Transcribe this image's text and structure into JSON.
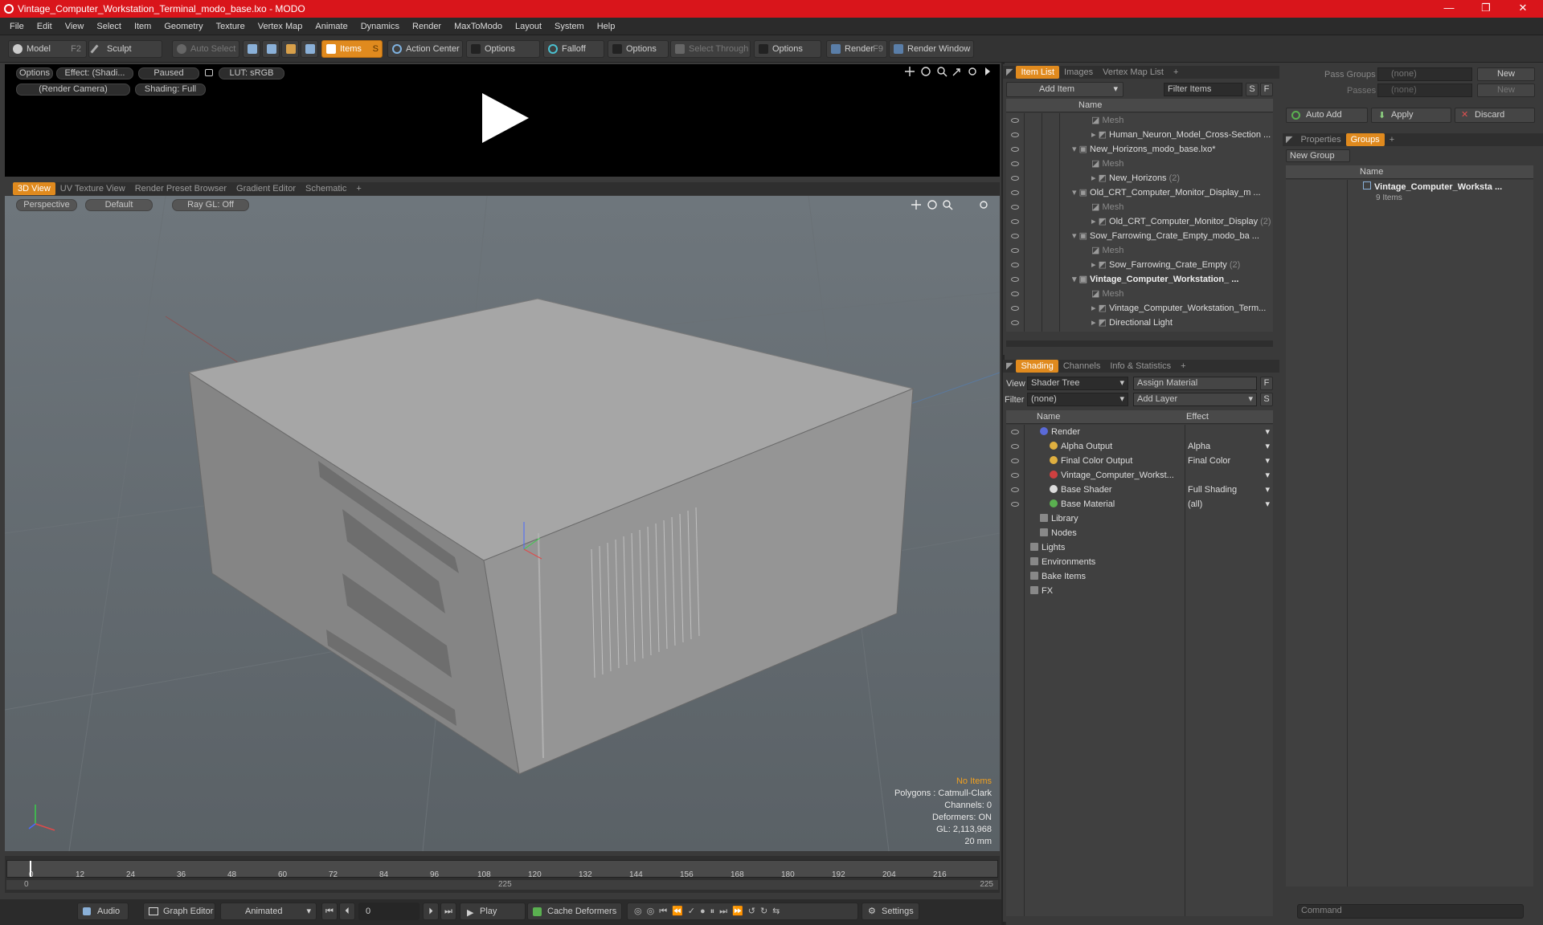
{
  "window": {
    "title": "Vintage_Computer_Workstation_Terminal_modo_base.lxo - MODO",
    "min": "—",
    "max": "❐",
    "close": "✕"
  },
  "menu": [
    "File",
    "Edit",
    "View",
    "Select",
    "Item",
    "Geometry",
    "Texture",
    "Vertex Map",
    "Animate",
    "Dynamics",
    "Render",
    "MaxToModo",
    "Layout",
    "System",
    "Help"
  ],
  "toolbar": {
    "model": "Model",
    "model_key": "F2",
    "sculpt": "Sculpt",
    "auto_select": "Auto Select",
    "items": "Items",
    "items_key": "S",
    "action_center": "Action Center",
    "options1": "Options",
    "falloff": "Falloff",
    "options2": "Options",
    "select_through": "Select Through",
    "options3": "Options",
    "render": "Render",
    "render_key": "F9",
    "render_window": "Render Window"
  },
  "preview": {
    "options": "Options",
    "effect": "Effect: (Shadi...",
    "paused": "Paused",
    "lut": "LUT: sRGB",
    "camera": "(Render Camera)",
    "shading": "Shading: Full"
  },
  "view_tabs": [
    "3D View",
    "UV Texture View",
    "Render Preset Browser",
    "Gradient Editor",
    "Schematic",
    "+"
  ],
  "viewport": {
    "perspective": "Perspective",
    "default": "Default",
    "raygl": "Ray GL: Off",
    "hud": {
      "no_items": "No Items",
      "polygons": "Polygons : Catmull-Clark",
      "channels": "Channels: 0",
      "deformers": "Deformers: ON",
      "gl": "GL: 2,113,968",
      "scale": "20 mm"
    }
  },
  "timeline": {
    "ticks": [
      "0",
      "12",
      "24",
      "36",
      "48",
      "60",
      "72",
      "84",
      "96",
      "108",
      "120",
      "132",
      "144",
      "156",
      "168",
      "180",
      "192",
      "204",
      "216"
    ],
    "start": "0",
    "mid": "225",
    "end": "225"
  },
  "bottombar": {
    "audio": "Audio",
    "graph_editor": "Graph Editor",
    "animated": "Animated",
    "frame": "0",
    "play": "Play",
    "cache": "Cache Deformers",
    "settings": "Settings"
  },
  "itemlist": {
    "tabs": [
      "Item List",
      "Images",
      "Vertex Map List",
      "+"
    ],
    "add_item": "Add Item",
    "filter": "Filter Items",
    "s": "S",
    "f": "F",
    "col_name": "Name",
    "rows": [
      {
        "label": "Mesh",
        "kind": "dim",
        "indent": 3
      },
      {
        "label": "Human_Neuron_Model_Cross-Section ...",
        "kind": "norm",
        "indent": 3
      },
      {
        "label": "New_Horizons_modo_base.lxo*",
        "kind": "norm",
        "indent": 1
      },
      {
        "label": "Mesh",
        "kind": "dim",
        "indent": 3
      },
      {
        "label": "New_Horizons",
        "count": "(2)",
        "kind": "norm",
        "indent": 3
      },
      {
        "label": "Old_CRT_Computer_Monitor_Display_m ...",
        "kind": "norm",
        "indent": 1
      },
      {
        "label": "Mesh",
        "kind": "dim",
        "indent": 3
      },
      {
        "label": "Old_CRT_Computer_Monitor_Display",
        "count": "(2)",
        "kind": "norm",
        "indent": 3
      },
      {
        "label": "Sow_Farrowing_Crate_Empty_modo_ba ...",
        "kind": "norm",
        "indent": 1
      },
      {
        "label": "Mesh",
        "kind": "dim",
        "indent": 3
      },
      {
        "label": "Sow_Farrowing_Crate_Empty",
        "count": "(2)",
        "kind": "norm",
        "indent": 3
      },
      {
        "label": "Vintage_Computer_Workstation_ ...",
        "kind": "bold",
        "indent": 1
      },
      {
        "label": "Mesh",
        "kind": "dim",
        "indent": 3
      },
      {
        "label": "Vintage_Computer_Workstation_Term...",
        "kind": "norm",
        "indent": 3
      },
      {
        "label": "Directional Light",
        "kind": "norm",
        "indent": 3
      }
    ]
  },
  "shading": {
    "tabs": [
      "Shading",
      "Channels",
      "Info & Statistics",
      "+"
    ],
    "view_label": "View",
    "view_value": "Shader Tree",
    "assign": "Assign Material",
    "filter_label": "Filter",
    "filter_value": "(none)",
    "add_layer": "Add Layer",
    "f": "F",
    "s": "S",
    "col_name": "Name",
    "col_effect": "Effect",
    "rows": [
      {
        "label": "Render",
        "effect": "",
        "indent": 1
      },
      {
        "label": "Alpha Output",
        "effect": "Alpha",
        "indent": 2
      },
      {
        "label": "Final Color Output",
        "effect": "Final Color",
        "indent": 2
      },
      {
        "label": "Vintage_Computer_Workst...",
        "effect": "",
        "indent": 2
      },
      {
        "label": "Base Shader",
        "effect": "Full Shading",
        "indent": 2
      },
      {
        "label": "Base Material",
        "effect": "(all)",
        "indent": 2
      },
      {
        "label": "Library",
        "effect": "",
        "indent": 1
      },
      {
        "label": "Nodes",
        "effect": "",
        "indent": 1
      },
      {
        "label": "Lights",
        "effect": "",
        "indent": 0
      },
      {
        "label": "Environments",
        "effect": "",
        "indent": 0
      },
      {
        "label": "Bake Items",
        "effect": "",
        "indent": 0
      },
      {
        "label": "FX",
        "effect": "",
        "indent": 0
      }
    ]
  },
  "groups": {
    "pass_groups": "Pass Groups",
    "passes": "Passes",
    "none": "(none)",
    "new": "New",
    "auto_add": "Auto Add",
    "apply": "Apply",
    "discard": "Discard",
    "tabs": [
      "Properties",
      "Groups",
      "+"
    ],
    "new_group": "New Group",
    "col_name": "Name",
    "item": "Vintage_Computer_Worksta ...",
    "item_count": "9 Items"
  },
  "command": {
    "placeholder": "Command"
  }
}
